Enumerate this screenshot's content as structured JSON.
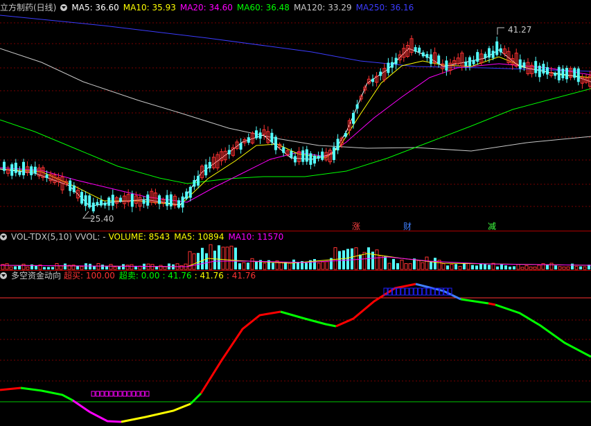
{
  "price_pane": {
    "title": "立方制药(日线)",
    "ma": [
      {
        "label": "MA5: 36.60",
        "color": "#ffffff"
      },
      {
        "label": "MA10: 35.93",
        "color": "#ffff00"
      },
      {
        "label": "MA20: 34.60",
        "color": "#ff00ff"
      },
      {
        "label": "MA60: 36.48",
        "color": "#00ff00"
      },
      {
        "label": "MA120: 33.29",
        "color": "#c8c8c8"
      },
      {
        "label": "MA250: 36.16",
        "color": "#3c3cff"
      }
    ],
    "high_label": "41.27",
    "low_label": "25.40",
    "markers": [
      {
        "text": "涨",
        "color": "#ff4040"
      },
      {
        "text": "财",
        "color": "#4080ff"
      },
      {
        "text": "减",
        "color": "#40ff40"
      }
    ],
    "colors": {
      "up": "#ff3232",
      "down": "#54ffff",
      "ma5": "#ffffff",
      "ma10": "#ffff00",
      "ma20": "#ff00ff",
      "ma60": "#00ff00",
      "ma120": "#c8c8c8",
      "ma250": "#3c3cff"
    }
  },
  "volume_pane": {
    "title": "VOL-TDX(5,10)",
    "vvol": "VVOL: -",
    "volume": "VOLUME: 8543",
    "ma5": "MA5: 10894",
    "ma10": "MA10: 11570"
  },
  "indicator_pane": {
    "title": "多空资金动向",
    "overbought": "超买: 100.00",
    "oversold": "超卖: 0.00",
    "v1": ": 41.76",
    "v2": ": 41.76",
    "v3": ": 41.76"
  }
}
